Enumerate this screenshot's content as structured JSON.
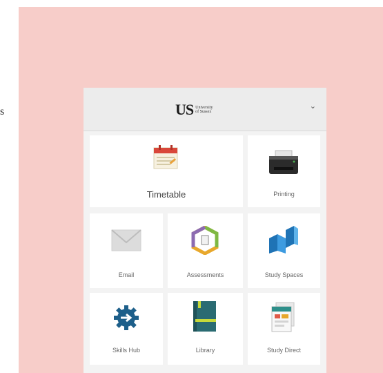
{
  "page": {
    "stray_text": "s"
  },
  "header": {
    "logo_mark": "US",
    "logo_text_line1": "University",
    "logo_text_line2": "of Sussex"
  },
  "tiles": [
    {
      "label": "Timetable",
      "icon": "calendar-icon"
    },
    {
      "label": "Printing",
      "icon": "printer-icon"
    },
    {
      "label": "Email",
      "icon": "envelope-icon"
    },
    {
      "label": "Assessments",
      "icon": "hexagon-document-icon"
    },
    {
      "label": "Study Spaces",
      "icon": "folded-blocks-icon"
    },
    {
      "label": "Skills Hub",
      "icon": "gear-arrow-icon"
    },
    {
      "label": "Library",
      "icon": "book-icon"
    },
    {
      "label": "Study Direct",
      "icon": "documents-icon"
    }
  ],
  "colors": {
    "background": "#f7cdc9",
    "teal": "#2a6b72",
    "blue": "#2e8fd0",
    "red": "#e05a48"
  }
}
